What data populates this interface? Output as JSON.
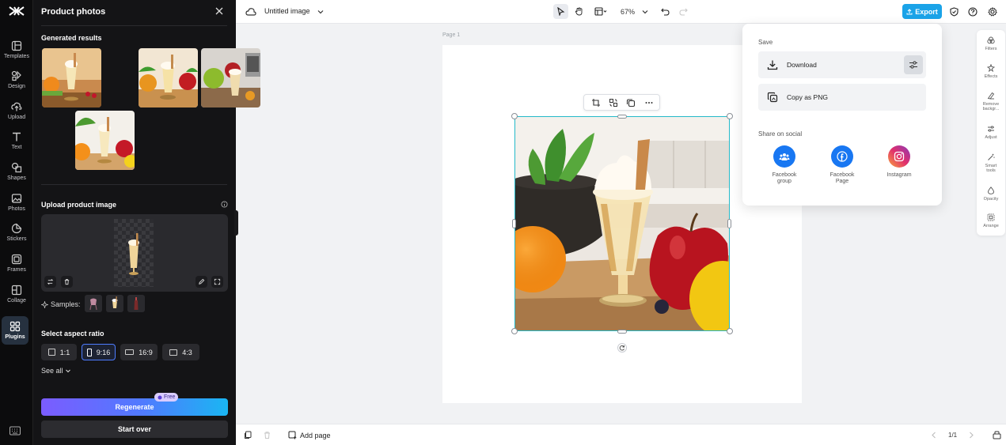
{
  "nav": {
    "items": [
      {
        "label": "Templates",
        "icon": "templates-icon"
      },
      {
        "label": "Design",
        "icon": "design-icon"
      },
      {
        "label": "Upload",
        "icon": "upload-icon"
      },
      {
        "label": "Text",
        "icon": "text-icon"
      },
      {
        "label": "Shapes",
        "icon": "shapes-icon"
      },
      {
        "label": "Photos",
        "icon": "photos-icon"
      },
      {
        "label": "Stickers",
        "icon": "stickers-icon"
      },
      {
        "label": "Frames",
        "icon": "frames-icon"
      },
      {
        "label": "Collage",
        "icon": "collage-icon"
      },
      {
        "label": "Plugins",
        "icon": "plugins-icon",
        "active": true
      }
    ]
  },
  "panel": {
    "title": "Product photos",
    "generated_title": "Generated results",
    "upload_title": "Upload product image",
    "samples_label": "Samples:",
    "aspect_title": "Select aspect ratio",
    "aspect_options": [
      {
        "label": "1:1"
      },
      {
        "label": "9:16",
        "selected": true
      },
      {
        "label": "16:9"
      },
      {
        "label": "4:3"
      }
    ],
    "see_all": "See all",
    "regenerate": "Regenerate",
    "free_badge": "Free",
    "start_over": "Start over"
  },
  "topbar": {
    "doc_title": "Untitled image",
    "zoom": "67%",
    "export_label": "Export"
  },
  "canvas": {
    "page_label": "Page 1"
  },
  "export_menu": {
    "save_label": "Save",
    "download": "Download",
    "copy_png": "Copy as PNG",
    "share_label": "Share on social",
    "social": [
      {
        "line1": "Facebook",
        "line2": "group",
        "color": "#1877f2"
      },
      {
        "line1": "Facebook",
        "line2": "Page",
        "color": "#1877f2"
      },
      {
        "line1": "Instagram",
        "line2": "",
        "color": "#e1306c"
      }
    ]
  },
  "right_tools": [
    {
      "line1": "Filters",
      "line2": ""
    },
    {
      "line1": "Effects",
      "line2": ""
    },
    {
      "line1": "Remove",
      "line2": "backgr..."
    },
    {
      "line1": "Adjust",
      "line2": ""
    },
    {
      "line1": "Smart",
      "line2": "tools"
    },
    {
      "line1": "Opacity",
      "line2": ""
    },
    {
      "line1": "Arrange",
      "line2": ""
    }
  ],
  "bottombar": {
    "add_page": "Add page",
    "page_count": "1/1"
  },
  "colors": {
    "accent": "#1aa3e8",
    "selection": "#25b9c9",
    "panel_bg": "#141416"
  }
}
